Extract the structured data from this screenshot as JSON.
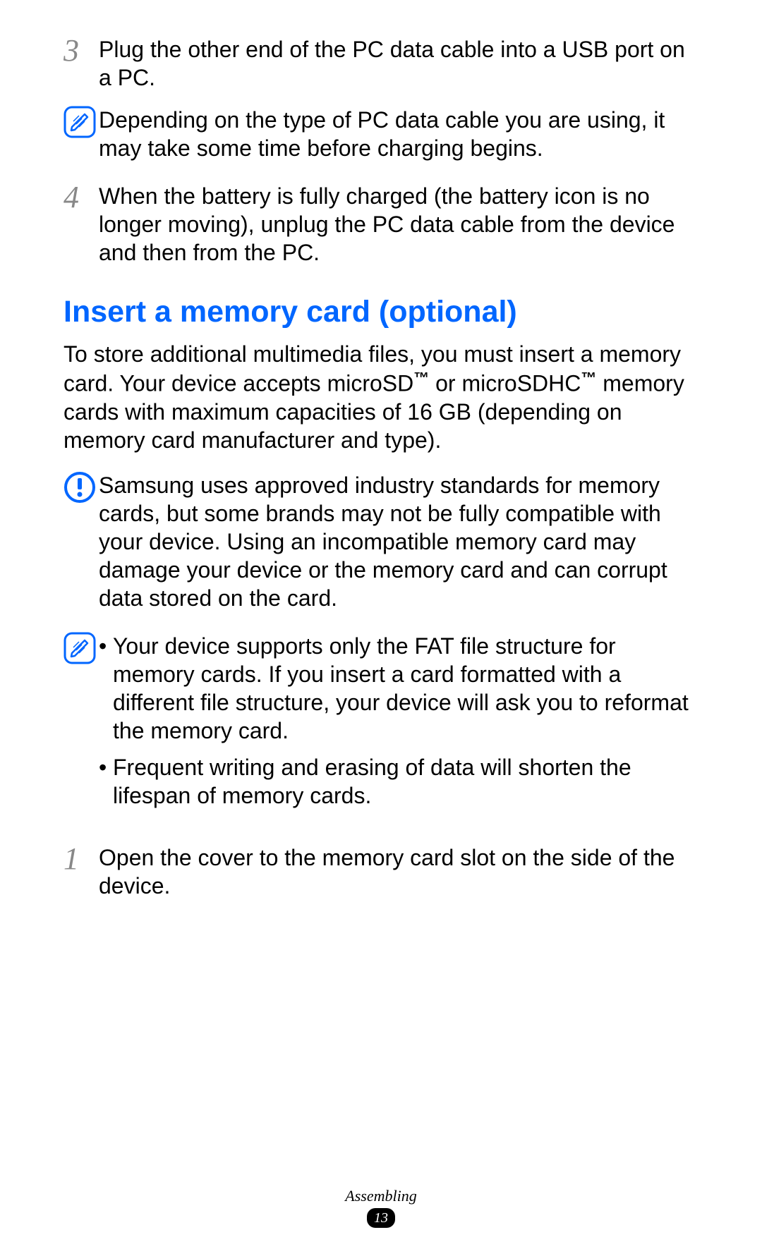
{
  "steps": {
    "s3": {
      "num": "3",
      "text": "Plug the other end of the PC data cable into a USB port on a PC."
    },
    "s4": {
      "num": "4",
      "text": "When the battery is fully charged (the battery icon is no longer moving), unplug the PC data cable from the device and then from the PC."
    },
    "s1b": {
      "num": "1",
      "text": "Open the cover to the memory card slot on the side of the device."
    }
  },
  "notes": {
    "n1": "Depending on the type of PC data cable you are using, it may take some time before charging begins.",
    "n2": "Samsung uses approved industry standards for memory cards, but some brands may not be fully compatible with your device. Using an incompatible memory card may damage your device or the memory card and can corrupt data stored on the card.",
    "n3": {
      "b1": "Your device supports only the FAT file structure for memory cards. If you insert a card formatted with a different file structure, your device will ask you to reformat the memory card.",
      "b2": "Frequent writing and erasing of data will shorten the lifespan of memory cards."
    }
  },
  "heading": "Insert a memory card (optional)",
  "intro": {
    "p1a": "To store additional multimedia files, you must insert a memory card. Your device accepts microSD",
    "p1b": " or microSDHC",
    "p1c": " memory cards with maximum capacities of 16 GB (depending on memory card manufacturer and type).",
    "tm": "™"
  },
  "footer": {
    "section": "Assembling",
    "page": "13"
  }
}
